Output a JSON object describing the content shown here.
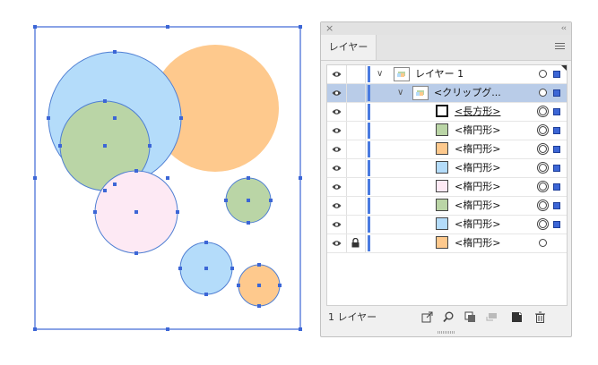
{
  "colors": {
    "blue": "#b4dcfa",
    "orange": "#fec98d",
    "green": "#bad5a6",
    "pink": "#fde9f4",
    "selection": "#3c66d6",
    "row_highlight": "#b9cce8"
  },
  "canvas": {
    "shapes": [
      {
        "name": "orange-circle-large",
        "fill": "orange"
      },
      {
        "name": "blue-circle-large",
        "fill": "blue"
      },
      {
        "name": "green-circle-large",
        "fill": "green"
      },
      {
        "name": "pink-circle",
        "fill": "pink"
      },
      {
        "name": "green-circle-small",
        "fill": "green"
      },
      {
        "name": "blue-circle-small",
        "fill": "blue"
      },
      {
        "name": "orange-circle-small",
        "fill": "orange"
      }
    ]
  },
  "panel": {
    "close_icon": "×",
    "collapse_icon": "‹‹",
    "tab_label": "レイヤー",
    "menu_icon": "hamburger-icon",
    "rows": [
      {
        "label": "レイヤー 1",
        "icon": "layer-thumbnail",
        "visible": true,
        "locked": false
      },
      {
        "label": "<クリップグ...",
        "icon": "layer-thumbnail",
        "visible": true,
        "locked": false
      },
      {
        "label": "<長方形>",
        "thumb_color": "#ffffff",
        "visible": true,
        "locked": false
      },
      {
        "label": "<楕円形>",
        "thumb_color": "#bad5a6",
        "visible": true,
        "locked": false
      },
      {
        "label": "<楕円形>",
        "thumb_color": "#fec98d",
        "visible": true,
        "locked": false
      },
      {
        "label": "<楕円形>",
        "thumb_color": "#b4dcfa",
        "visible": true,
        "locked": false
      },
      {
        "label": "<楕円形>",
        "thumb_color": "#fde9f4",
        "visible": true,
        "locked": false
      },
      {
        "label": "<楕円形>",
        "thumb_color": "#bad5a6",
        "visible": true,
        "locked": false
      },
      {
        "label": "<楕円形>",
        "thumb_color": "#b4dcfa",
        "visible": true,
        "locked": false
      },
      {
        "label": "<楕円形>",
        "thumb_color": "#fec98d",
        "visible": true,
        "locked": true
      }
    ],
    "footer": {
      "layer_count": "1 レイヤー",
      "icons": [
        "export-icon",
        "search-icon",
        "clipping-mask-icon",
        "sublayer-icon",
        "new-layer-icon",
        "trash-icon"
      ]
    }
  }
}
